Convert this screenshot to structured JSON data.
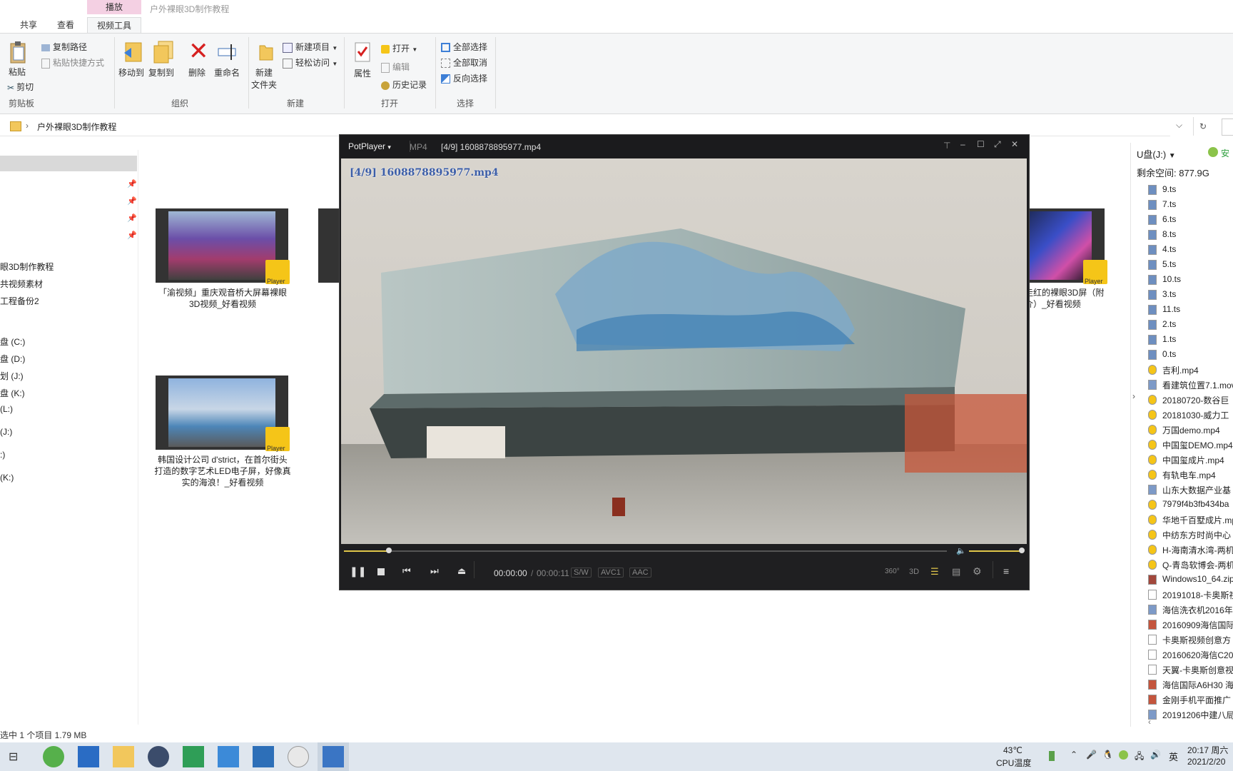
{
  "explorer": {
    "window_title": "户外裸眼3D制作教程",
    "context_tab": "播放",
    "tabs": [
      "共享",
      "查看",
      "视频工具"
    ],
    "ribbon": {
      "copy_path": "复制路径",
      "paste_shortcut": "粘贴快捷方式",
      "paste": "粘贴",
      "cut": "剪切",
      "clipboard_group": "剪贴板",
      "move_to": "移动到",
      "copy_to": "复制到",
      "delete": "删除",
      "rename": "重命名",
      "organize_group": "组织",
      "new_folder_l1": "新建",
      "new_folder_l2": "文件夹",
      "new_item": "新建项目",
      "easy_access": "轻松访问",
      "new_group": "新建",
      "properties": "属性",
      "open": "打开",
      "edit": "编辑",
      "history": "历史记录",
      "open_group": "打开",
      "select_all": "全部选择",
      "select_none": "全部取消",
      "invert_select": "反向选择",
      "select_group": "选择"
    },
    "address": {
      "path": "户外裸眼3D制作教程"
    },
    "nav": {
      "items": [
        "眼3D制作教程",
        "共视频素材",
        "工程备份2",
        "盘 (C:)",
        "盘 (D:)",
        "划 (J:)",
        "盘 (K:)",
        "(L:)",
        "(J:)",
        ":)",
        "(K:)"
      ]
    },
    "thumbnails": [
      {
        "caption_l1": "「渝视频」重庆观音桥大屏幕裸眼",
        "caption_l2": "3D视频_好看视频",
        "badge": "Player"
      },
      {
        "caption_l1": "韩国设计公司 d'strict，在首尔街头",
        "caption_l2": "打造的数字艺术LED电子屏，好像真",
        "caption_l3": "实的海浪！_好看视频",
        "badge": "Player"
      },
      {
        "caption_l1": "走红的裸眼3D屏（附",
        "caption_l2": "介）_好看视频",
        "badge": "Player"
      }
    ],
    "status": "选中 1 个项目  1.79 MB"
  },
  "player": {
    "app_name": "PotPlayer",
    "format": "MP4",
    "title": "[4/9] 1608878895977.mp4",
    "osd": "[4/9] 1608878895977.mp4",
    "time_current": "00:00:00",
    "time_sep": "/",
    "time_total": "00:00:11",
    "tag_sw": "S/W",
    "tag_video": "AVC1",
    "tag_audio": "AAC",
    "btn_360": "360°",
    "btn_3d": "3D",
    "progress": 0.075,
    "volume": 1.0
  },
  "right_pane": {
    "drive": "U盘(J:)",
    "free_space": "剩余空间: 877.9G",
    "install": "安",
    "files": [
      {
        "name": "9.ts",
        "kind": "ts"
      },
      {
        "name": "7.ts",
        "kind": "ts"
      },
      {
        "name": "6.ts",
        "kind": "ts"
      },
      {
        "name": "8.ts",
        "kind": "ts"
      },
      {
        "name": "4.ts",
        "kind": "ts"
      },
      {
        "name": "5.ts",
        "kind": "ts"
      },
      {
        "name": "10.ts",
        "kind": "ts"
      },
      {
        "name": "3.ts",
        "kind": "ts"
      },
      {
        "name": "11.ts",
        "kind": "ts"
      },
      {
        "name": "2.ts",
        "kind": "ts"
      },
      {
        "name": "1.ts",
        "kind": "ts"
      },
      {
        "name": "0.ts",
        "kind": "ts"
      },
      {
        "name": "吉利.mp4",
        "kind": "video"
      },
      {
        "name": "看建筑位置7.1.mov",
        "kind": "doc"
      },
      {
        "name": "20180720-数谷巨",
        "kind": "video"
      },
      {
        "name": "20181030-威力工",
        "kind": "video"
      },
      {
        "name": "万国demo.mp4",
        "kind": "video"
      },
      {
        "name": "中国玺DEMO.mp4",
        "kind": "video"
      },
      {
        "name": "中国玺成片.mp4",
        "kind": "video"
      },
      {
        "name": "有轨电车.mp4",
        "kind": "video"
      },
      {
        "name": "山东大数据产业基",
        "kind": "doc"
      },
      {
        "name": "7979f4b3fb434ba",
        "kind": "video"
      },
      {
        "name": "华地千百墅成片.mp",
        "kind": "video"
      },
      {
        "name": "中纺东方时尚中心",
        "kind": "video"
      },
      {
        "name": "H-海南清水湾-两机",
        "kind": "video"
      },
      {
        "name": "Q-青岛软博会-两机",
        "kind": "video"
      },
      {
        "name": "Windows10_64.zip",
        "kind": "zip"
      },
      {
        "name": "20191018-卡奥斯视",
        "kind": "blank"
      },
      {
        "name": "海信洗衣机2016年",
        "kind": "doc"
      },
      {
        "name": "20160909海信国际",
        "kind": "pdf"
      },
      {
        "name": "卡奥斯视频创意方",
        "kind": "blank"
      },
      {
        "name": "20160620海信C20",
        "kind": "blank"
      },
      {
        "name": "天翼-卡奥斯创意视",
        "kind": "blank"
      },
      {
        "name": "海信国际A6H30 海",
        "kind": "pdf"
      },
      {
        "name": "金刚手机平面推广",
        "kind": "pdf"
      },
      {
        "name": "20191206中建八局",
        "kind": "doc"
      }
    ]
  },
  "taskbar": {
    "temp": "43℃",
    "temp_label": "CPU温度",
    "ime": "英",
    "time": "20:17 周六",
    "date": "2021/2/20"
  },
  "colors": {
    "accent": "#f5c518",
    "ribbon_bg": "#f5f6f7",
    "player_bg": "#1d1d1f",
    "context_tab": "#f4d0e3",
    "taskbar": "#dfe6ee"
  }
}
